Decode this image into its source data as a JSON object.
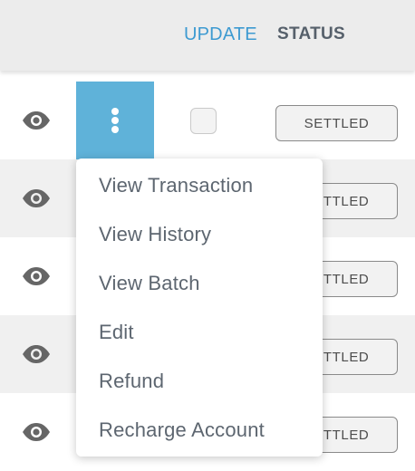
{
  "header": {
    "update_label": "UPDATE",
    "status_label": "STATUS"
  },
  "colors": {
    "accent": "#3d9ad1",
    "kebab_active": "#5fb2d9",
    "row_alt": "#f0f0f0",
    "text_muted": "#5d6670"
  },
  "rows": [
    {
      "status": "SETTLED",
      "kebab_active": true
    },
    {
      "status": "SETTLED"
    },
    {
      "status": "SETTLED"
    },
    {
      "status": "SETTLED"
    },
    {
      "status": "SETTLED"
    }
  ],
  "icons": {
    "view": "eye-icon",
    "actions": "vertical-ellipsis-icon"
  },
  "context_menu": {
    "items": [
      "View Transaction",
      "View History",
      "View Batch",
      "Edit",
      "Refund",
      "Recharge Account"
    ]
  }
}
